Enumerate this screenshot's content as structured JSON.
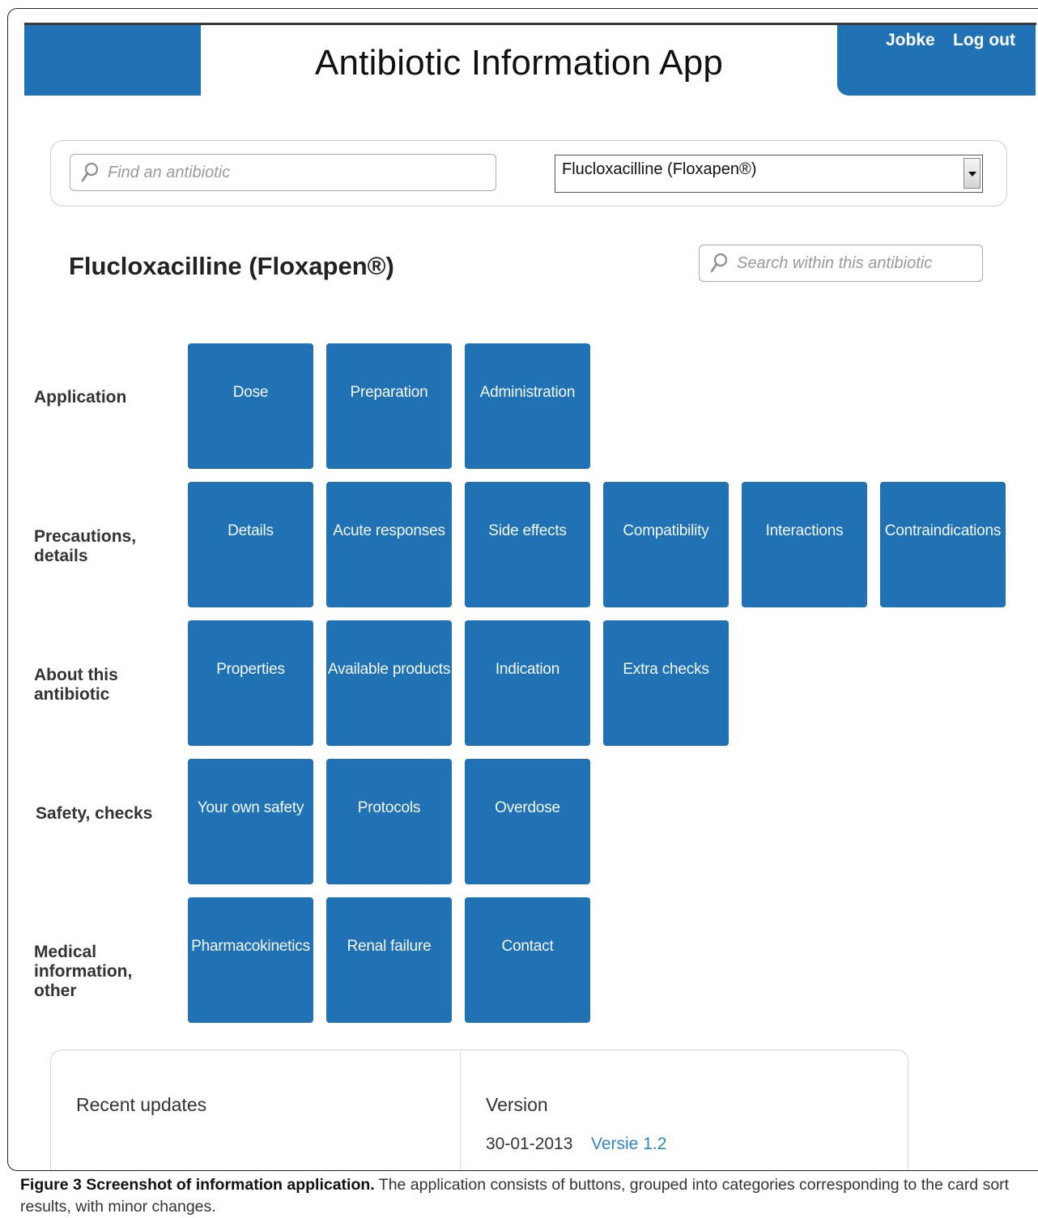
{
  "header": {
    "app_title": "Antibiotic Information App",
    "user_name": "Jobke",
    "logout_label": "Log out",
    "accent_color": "#2072b4"
  },
  "search": {
    "find_placeholder": "Find an antibiotic",
    "selected_antibiotic": "Flucloxacilline (Floxapen®)",
    "search_icon": "magnifier-icon",
    "dropdown_icon": "chevron-down-icon"
  },
  "drug": {
    "title": "Flucloxacilline (Floxapen®)",
    "inner_search_placeholder": "Search within this antibiotic"
  },
  "categories": [
    {
      "label": "Application",
      "buttons": [
        "Dose",
        "Preparation",
        "Administration"
      ]
    },
    {
      "label": "Precautions,\ndetails",
      "buttons": [
        "Details",
        "Acute responses",
        "Side effects",
        "Compatibility",
        "Interactions",
        "Contraindications"
      ]
    },
    {
      "label": "About this\nantibiotic",
      "buttons": [
        "Properties",
        "Available products",
        "Indication",
        "Extra checks"
      ]
    },
    {
      "label": "Safety, checks",
      "buttons": [
        "Your own safety",
        "Protocols",
        "Overdose"
      ]
    },
    {
      "label": "Medical\ninformation,\nother",
      "buttons": [
        "Pharmacokinetics",
        "Renal failure",
        "Contact"
      ]
    }
  ],
  "footer": {
    "recent_updates_heading": "Recent updates",
    "version_heading": "Version",
    "version_date": "30-01-2013",
    "version_link": "Versie 1.2"
  },
  "caption": {
    "bold": "Figure 3 Screenshot of information application.",
    "text": " The application consists of buttons, grouped into categories corresponding to the card sort results, with minor changes."
  }
}
